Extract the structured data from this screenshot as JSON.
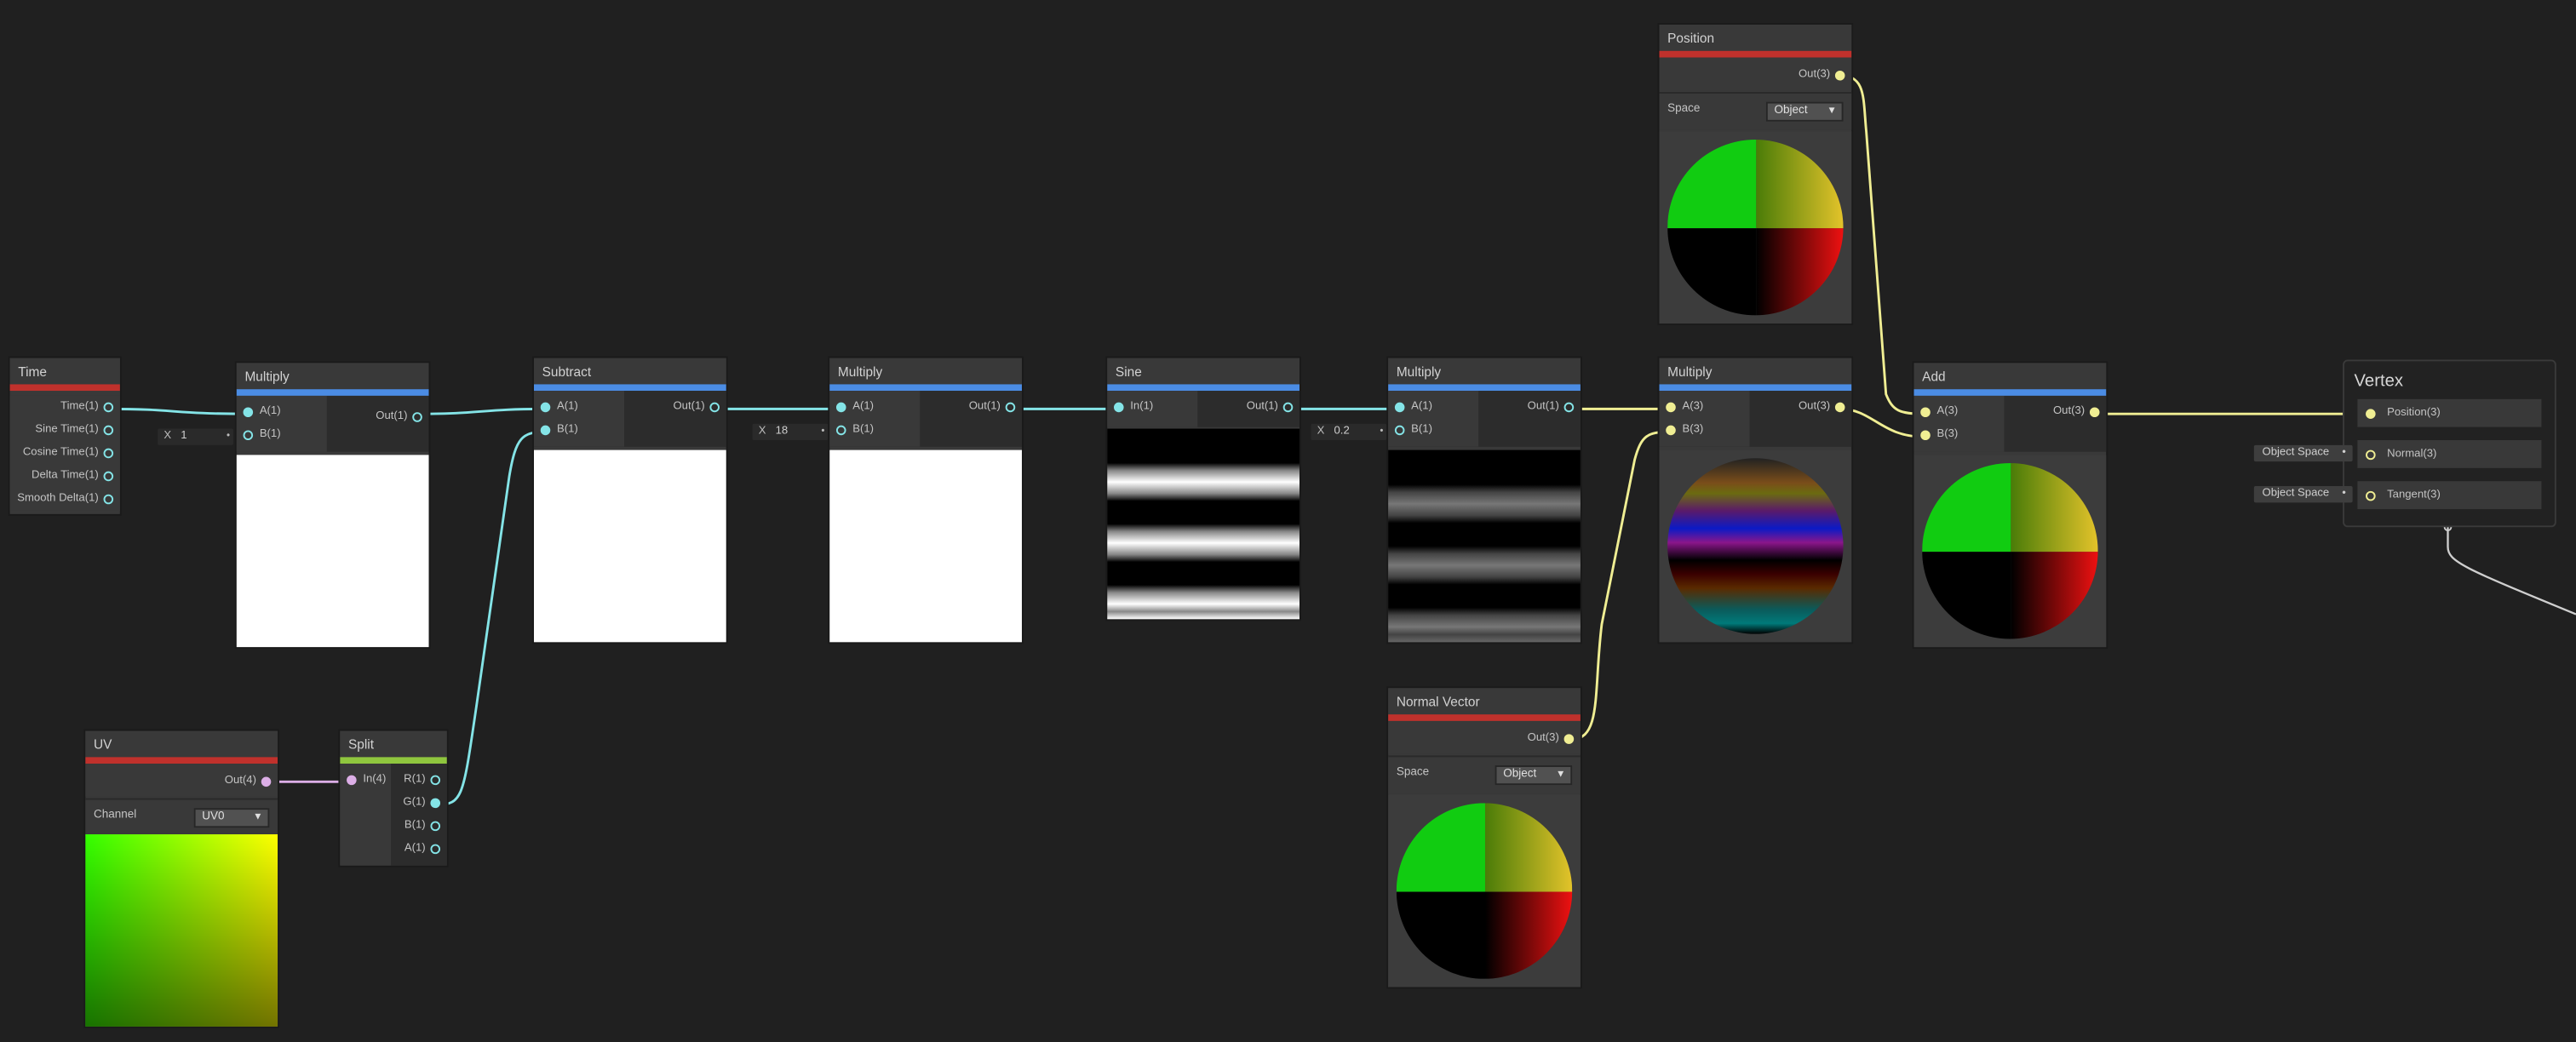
{
  "nodes": {
    "time": {
      "title": "Time",
      "outputs": [
        "Time(1)",
        "Sine Time(1)",
        "Cosine Time(1)",
        "Delta Time(1)",
        "Smooth Delta(1)"
      ]
    },
    "multiply1": {
      "title": "Multiply",
      "inputs": [
        "A(1)",
        "B(1)"
      ],
      "output": "Out(1)",
      "b_axis": "X",
      "b_value": "1"
    },
    "subtract": {
      "title": "Subtract",
      "inputs": [
        "A(1)",
        "B(1)"
      ],
      "output": "Out(1)"
    },
    "multiply2": {
      "title": "Multiply",
      "inputs": [
        "A(1)",
        "B(1)"
      ],
      "output": "Out(1)",
      "b_axis": "X",
      "b_value": "18"
    },
    "sine": {
      "title": "Sine",
      "inputs": [
        "In(1)"
      ],
      "output": "Out(1)"
    },
    "multiply3": {
      "title": "Multiply",
      "inputs": [
        "A(1)",
        "B(1)"
      ],
      "output": "Out(1)",
      "b_axis": "X",
      "b_value": "0.2"
    },
    "multiply4": {
      "title": "Multiply",
      "inputs": [
        "A(3)",
        "B(3)"
      ],
      "output": "Out(3)"
    },
    "add": {
      "title": "Add",
      "inputs": [
        "A(3)",
        "B(3)"
      ],
      "output": "Out(3)"
    },
    "position": {
      "title": "Position",
      "output": "Out(3)",
      "space_label": "Space",
      "space_value": "Object"
    },
    "normal_vector": {
      "title": "Normal Vector",
      "output": "Out(3)",
      "space_label": "Space",
      "space_value": "Object"
    },
    "uv": {
      "title": "UV",
      "output": "Out(4)",
      "channel_label": "Channel",
      "channel_value": "UV0"
    },
    "split": {
      "title": "Split",
      "input": "In(4)",
      "outputs": [
        "R(1)",
        "G(1)",
        "B(1)",
        "A(1)"
      ]
    }
  },
  "vertex": {
    "title": "Vertex",
    "ports": [
      "Position(3)",
      "Normal(3)",
      "Tangent(3)"
    ],
    "normal_space": "Object Space",
    "tangent_space": "Object Space"
  },
  "colors": {
    "background": "#202020",
    "float_wire": "#84e4e7",
    "vector3_wire": "#f0ee93",
    "vector4_wire": "#dcaee6",
    "property_bar": "#c0312c",
    "math_bar": "#4b8ce4",
    "channel_bar": "#8fc63e"
  },
  "icons": {
    "port": "port-dot-icon",
    "dropdown": "dropdown-arrow-icon"
  }
}
